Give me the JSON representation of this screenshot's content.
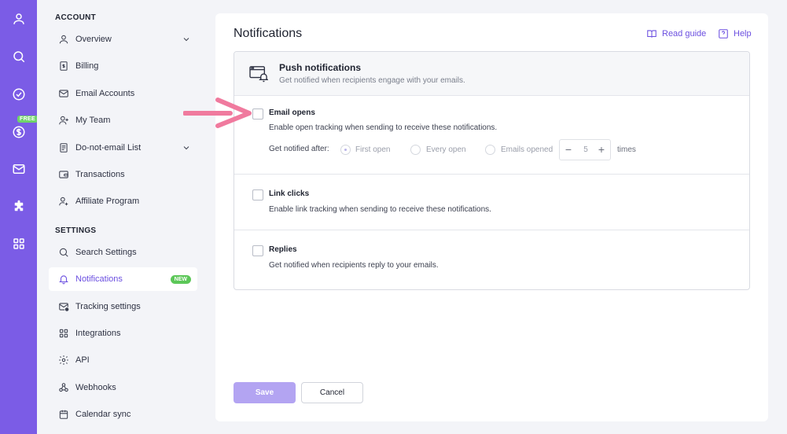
{
  "rail": {
    "free_badge": "FREE",
    "icons": [
      "user-icon",
      "search-icon",
      "check-circle-icon",
      "dollar-icon",
      "mail-icon",
      "puzzle-icon",
      "grid-icon"
    ]
  },
  "nav": {
    "account_header": "ACCOUNT",
    "settings_header": "SETTINGS",
    "account_items": [
      {
        "label": "Overview"
      },
      {
        "label": "Billing"
      },
      {
        "label": "Email Accounts"
      },
      {
        "label": "My Team"
      },
      {
        "label": "Do-not-email List"
      },
      {
        "label": "Transactions"
      },
      {
        "label": "Affiliate Program"
      }
    ],
    "settings_items": [
      {
        "label": "Search Settings"
      },
      {
        "label": "Notifications",
        "badge": "NEW"
      },
      {
        "label": "Tracking settings"
      },
      {
        "label": "Integrations"
      },
      {
        "label": "API"
      },
      {
        "label": "Webhooks"
      },
      {
        "label": "Calendar sync"
      }
    ]
  },
  "main": {
    "title": "Notifications",
    "read_guide": "Read guide",
    "help": "Help",
    "card": {
      "title": "Push notifications",
      "subtitle": "Get notified when recipients engage with your emails.",
      "rows": [
        {
          "title": "Email opens",
          "desc": "Enable open tracking when sending to receive these notifications.",
          "notified_label": "Get notified after:",
          "options": [
            "First open",
            "Every open",
            "Emails opened"
          ],
          "stepper_value": "5",
          "times": "times"
        },
        {
          "title": "Link clicks",
          "desc": "Enable link tracking when sending to receive these notifications."
        },
        {
          "title": "Replies",
          "desc": "Get notified when recipients reply to your emails."
        }
      ]
    },
    "save": "Save",
    "cancel": "Cancel"
  },
  "colors": {
    "rail": "#7b5ce6",
    "accent": "#6b4fe0",
    "badge_green": "#5cc758",
    "arrow": "#f07a9e"
  }
}
